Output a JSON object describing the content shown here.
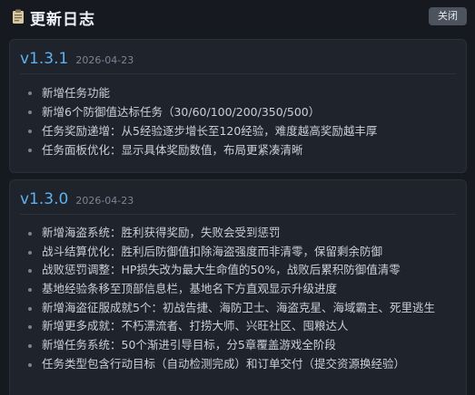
{
  "header": {
    "title": "更新日志",
    "close_label": "关闭"
  },
  "changelog": [
    {
      "version": "v1.3.1",
      "date": "2026-04-23",
      "items": [
        "新增任务功能",
        "新增6个防御值达标任务（30/60/100/200/350/500）",
        "任务奖励递增：从5经验逐步增长至120经验，难度越高奖励越丰厚",
        "任务面板优化：显示具体奖励数值，布局更紧凑清晰"
      ]
    },
    {
      "version": "v1.3.0",
      "date": "2026-04-23",
      "items": [
        "新增海盗系统：胜利获得奖励，失败会受到惩罚",
        "战斗结算优化：胜利后防御值扣除海盗强度而非清零，保留剩余防御",
        "战败惩罚调整：HP损失改为最大生命值的50%，战败后累积防御值清零",
        "基地经验条移至顶部信息栏，基地名下方直观显示升级进度",
        "新增海盗征服成就5个：初战告捷、海防卫士、海盗克星、海域霸主、死里逃生",
        "新增更多成就：不朽漂流者、打捞大师、兴旺社区、囤粮达人",
        "新增任务系统：50个渐进引导目标，分5章覆盖游戏全阶段",
        "任务类型包含行动目标（自动检测完成）和订单交付（提交资源换经验）"
      ]
    }
  ],
  "colors": {
    "background": "#16191f",
    "card": "#1e232c",
    "version_accent": "#5fb0ee",
    "close_button": "#4d535d"
  },
  "icons": {
    "title_icon": "clipboard-icon"
  }
}
